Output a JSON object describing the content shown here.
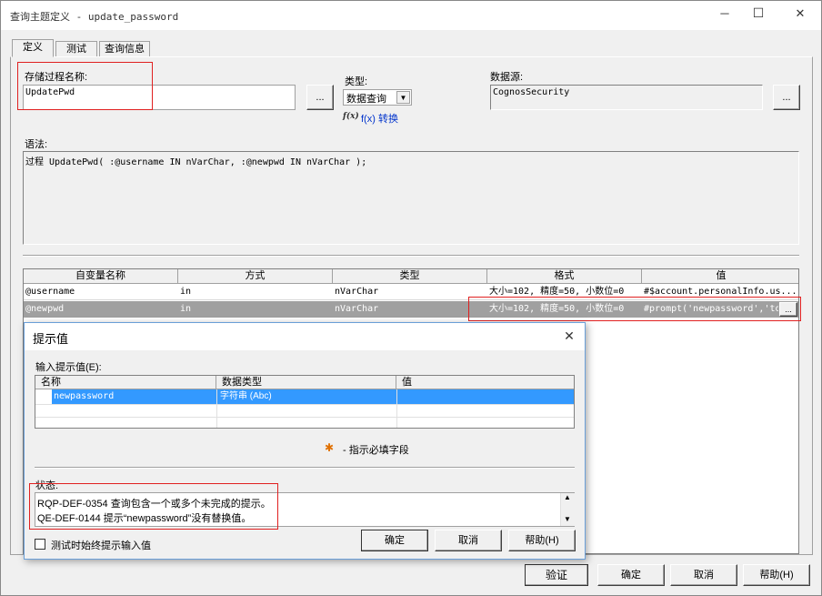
{
  "window": {
    "title": "查询主题定义 - update_password",
    "controls": {
      "minimize": "─",
      "maximize": "☐",
      "close": "✕"
    }
  },
  "tabs": [
    {
      "label": "定义",
      "active": true
    },
    {
      "label": "测试",
      "active": false
    },
    {
      "label": "查询信息",
      "active": false
    }
  ],
  "definition": {
    "proc_label": "存储过程名称:",
    "proc_value": "UpdatePwd",
    "browse_label": "...",
    "type_label": "类型:",
    "type_value": "数据查询",
    "fx_icon": "f(x)",
    "fx_link": "f(x) 转换",
    "datasource_label": "数据源:",
    "datasource_value": "CognosSecurity",
    "datasource_browse": "...",
    "syntax_label": "语法:",
    "syntax_value": "过程 UpdatePwd( :@username IN nVarChar, :@newpwd IN nVarChar );"
  },
  "params_table": {
    "columns": [
      "自变量名称",
      "方式",
      "类型",
      "格式",
      "值"
    ],
    "rows": [
      {
        "name": "@username",
        "mode": "in",
        "type": "nVarChar",
        "format": "大小=102, 精度=50, 小数位=0",
        "value": "#$account.personalInfo.us...",
        "selected": false
      },
      {
        "name": "@newpwd",
        "mode": "in",
        "type": "nVarChar",
        "format": "大小=102, 精度=50, 小数位=0",
        "value": "#prompt('newpassword','to",
        "selected": true,
        "ellipsis": "..."
      }
    ]
  },
  "bottom_buttons": {
    "validate": "验证",
    "ok": "确定",
    "cancel": "取消",
    "help": "帮助(H)"
  },
  "dialog": {
    "title": "提示值",
    "close": "✕",
    "input_label": "输入提示值(E):",
    "columns": [
      "名称",
      "数据类型",
      "值"
    ],
    "rows": [
      {
        "name": "newpassword",
        "type": "字符串 (Abc)",
        "value": "",
        "selected": true
      }
    ],
    "required_icon": "✱",
    "required_text": "- 指示必填字段",
    "status_label": "状态:",
    "status_lines": [
      "RQP-DEF-0354 查询包含一个或多个未完成的提示。",
      "QE-DEF-0144 提示“newpassword”没有替换值。"
    ],
    "checkbox_label": "测试时始终提示输入值",
    "checkbox_checked": false,
    "ok": "确定",
    "cancel": "取消",
    "help": "帮助(H)"
  },
  "colors": {
    "selection_gray": "#a0a0a0",
    "selection_blue": "#3399ff",
    "highlight_red": "#e02020",
    "link_blue": "#0033cc"
  }
}
